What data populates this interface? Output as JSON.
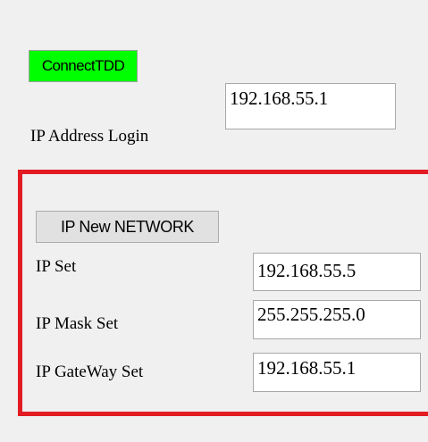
{
  "connect": {
    "label": "ConnectTDD",
    "color": "#00ff00"
  },
  "login": {
    "label": "IP Address Login",
    "value": "192.168.55.1"
  },
  "network": {
    "highlight_color": "#e31b23",
    "new_button_label": "IP New NETWORK",
    "ip_set": {
      "label": "IP Set",
      "value": "192.168.55.5"
    },
    "mask_set": {
      "label": "IP Mask Set",
      "value": "255.255.255.0"
    },
    "gateway_set": {
      "label": "IP GateWay Set",
      "value": "192.168.55.1"
    }
  }
}
